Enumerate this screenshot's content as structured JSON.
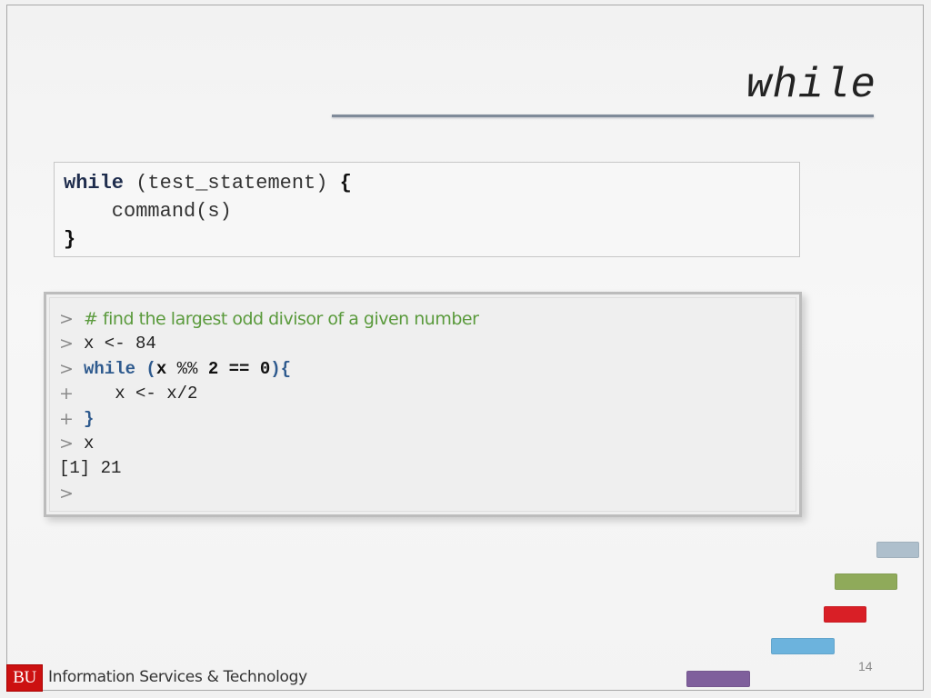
{
  "slide": {
    "title": "while",
    "page_number": "14"
  },
  "syntax": {
    "line1_keyword": "while",
    "line1_rest": " (test_statement) ",
    "line1_brace": "{",
    "line2": "    command(s)",
    "line3_brace": "}"
  },
  "console": {
    "lines": [
      {
        "prompt": ">",
        "comment": "# find the largest odd divisor of a given number"
      },
      {
        "prompt": ">",
        "code": "x <- 84"
      },
      {
        "prompt": ">",
        "tokens": [
          "while",
          " (",
          "x",
          " %% ",
          "2",
          " == ",
          "0",
          "){"
        ]
      },
      {
        "prompt": "+",
        "code": "   x <- x/2"
      },
      {
        "prompt": "+",
        "brace": "}"
      },
      {
        "prompt": ">",
        "code": "x"
      },
      {
        "output": "[1] 21"
      },
      {
        "prompt": ">"
      }
    ]
  },
  "footer": {
    "logo_text": "BU",
    "org_name": "Information Services & Technology"
  },
  "decoration": {
    "bars": [
      {
        "name": "gray-blue",
        "color": "#aebfcc"
      },
      {
        "name": "green",
        "color": "#8faa5a"
      },
      {
        "name": "red",
        "color": "#d91f26"
      },
      {
        "name": "light-blue",
        "color": "#6cb3dd"
      },
      {
        "name": "purple",
        "color": "#7f5f9c"
      }
    ]
  }
}
